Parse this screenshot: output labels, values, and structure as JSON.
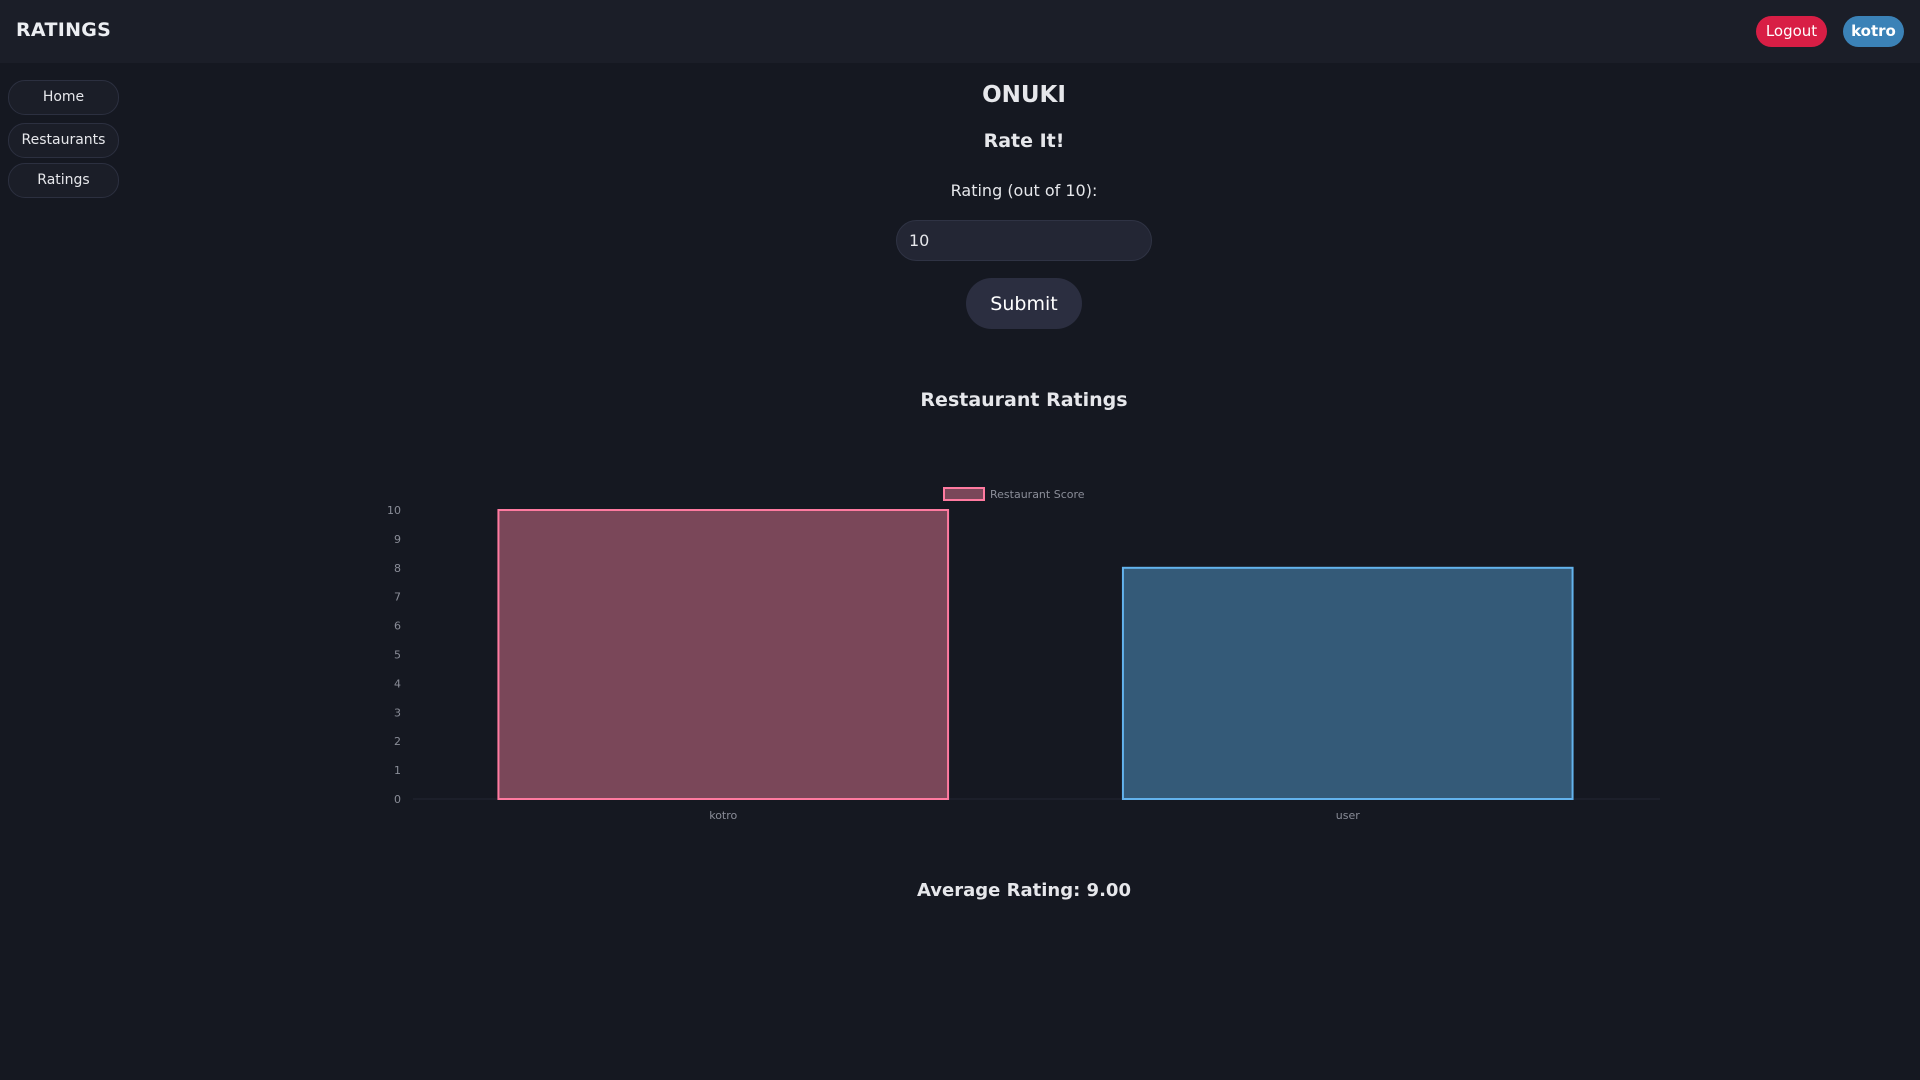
{
  "header": {
    "brand": "RATINGS",
    "logout_label": "Logout",
    "user_label": "kotro"
  },
  "sidebar": {
    "items": [
      {
        "label": "Home"
      },
      {
        "label": "Restaurants"
      },
      {
        "label": "Ratings"
      }
    ]
  },
  "main": {
    "restaurant_name": "ONUKI",
    "rate_heading": "Rate It!",
    "rating_label": "Rating (out of 10):",
    "rating_value": "10",
    "submit_label": "Submit",
    "chart_heading": "Restaurant Ratings",
    "average_text": "Average Rating: 9.00"
  },
  "colors": {
    "bar_1_fill": "#7a4759",
    "bar_1_stroke": "#ff7aa0",
    "bar_2_fill": "#345a78",
    "bar_2_stroke": "#63b3ed",
    "logout": "#d81e45",
    "user_badge": "#3b82b7"
  },
  "chart_data": {
    "type": "bar",
    "categories": [
      "kotro",
      "user"
    ],
    "series": [
      {
        "name": "Restaurant Score",
        "values": [
          10,
          8
        ]
      }
    ],
    "title": "",
    "xlabel": "",
    "ylabel": "",
    "ylim": [
      0,
      10
    ],
    "yticks": [
      0,
      1,
      2,
      3,
      4,
      5,
      6,
      7,
      8,
      9,
      10
    ],
    "legend_position": "top",
    "grid": false
  }
}
